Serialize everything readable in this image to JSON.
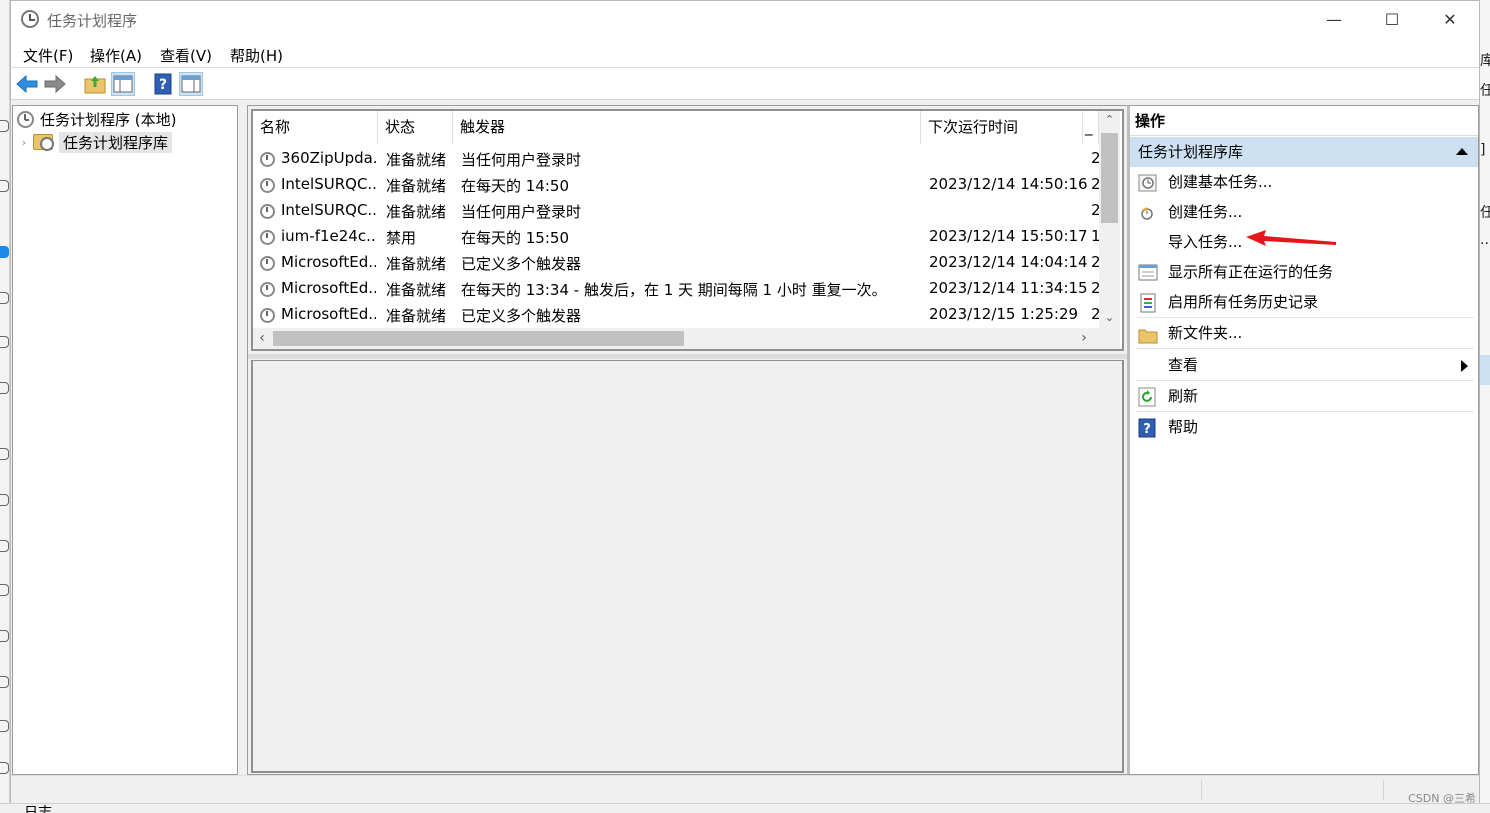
{
  "window": {
    "title": "任务计划程序",
    "controls": {
      "minimize": "—",
      "maximize": "☐",
      "close": "✕"
    }
  },
  "menu": [
    "文件(F)",
    "操作(A)",
    "查看(V)",
    "帮助(H)"
  ],
  "toolbar": {
    "icons": [
      "back-icon",
      "forward-icon",
      "folder-up-icon",
      "show-hide-console-tree-icon",
      "help-icon",
      "show-hide-action-pane-icon"
    ]
  },
  "tree": {
    "root_label": "任务计划程序 (本地)",
    "library_label": "任务计划程序库",
    "expander": "›"
  },
  "task_list": {
    "columns": [
      "名称",
      "状态",
      "触发器",
      "下次运行时间",
      "_"
    ],
    "rows": [
      {
        "name": "360ZipUpda...",
        "status": "准备就绪",
        "trigger": "当任何用户登录时",
        "next_run": "",
        "extra": "2"
      },
      {
        "name": "IntelSURQC...",
        "status": "准备就绪",
        "trigger": "在每天的 14:50",
        "next_run": "2023/12/14 14:50:16",
        "extra": "2"
      },
      {
        "name": "IntelSURQC...",
        "status": "准备就绪",
        "trigger": "当任何用户登录时",
        "next_run": "",
        "extra": "2"
      },
      {
        "name": "ium-f1e24c...",
        "status": "禁用",
        "trigger": "在每天的 15:50",
        "next_run": "2023/12/14 15:50:17",
        "extra": "1"
      },
      {
        "name": "MicrosoftEd...",
        "status": "准备就绪",
        "trigger": "已定义多个触发器",
        "next_run": "2023/12/14 14:04:14",
        "extra": "2"
      },
      {
        "name": "MicrosoftEd...",
        "status": "准备就绪",
        "trigger": "在每天的 13:34 - 触发后，在 1 天 期间每隔 1 小时 重复一次。",
        "next_run": "2023/12/14 11:34:15",
        "extra": "2"
      },
      {
        "name": "MicrosoftEd...",
        "status": "准备就绪",
        "trigger": "已定义多个触发器",
        "next_run": "2023/12/15 1:25:29",
        "extra": "2"
      }
    ],
    "scroll": {
      "up": "⌃",
      "down": "⌄",
      "left": "‹",
      "right": "›"
    }
  },
  "actions": {
    "title": "操作",
    "section": "任务计划程序库",
    "items": [
      {
        "label": "创建基本任务...",
        "icon": "create-basic-task-icon"
      },
      {
        "label": "创建任务...",
        "icon": "create-task-icon"
      },
      {
        "label": "导入任务...",
        "icon": ""
      },
      {
        "label": "显示所有正在运行的任务",
        "icon": "running-tasks-icon"
      },
      {
        "label": "启用所有任务历史记录",
        "icon": "task-history-icon"
      },
      {
        "label": "新文件夹...",
        "icon": "new-folder-icon"
      },
      {
        "label": "查看",
        "icon": ""
      },
      {
        "label": "刷新",
        "icon": "refresh-icon"
      },
      {
        "label": "帮助",
        "icon": "help-icon"
      }
    ]
  },
  "colors": {
    "selection": "#cde0f1",
    "annotation_arrow": "#e8141b"
  },
  "watermark": "CSDN @三希",
  "desktop_right_chars": [
    "库",
    "任",
    "]",
    "任",
    "..."
  ],
  "desktop_bottom": "日志"
}
